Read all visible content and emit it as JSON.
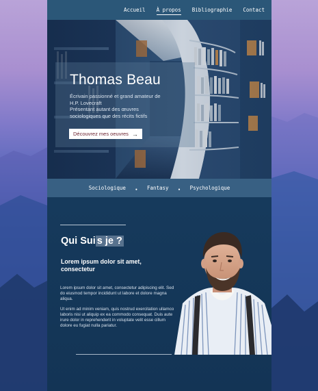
{
  "nav": {
    "items": [
      "Accueil",
      "À propos",
      "Bibliographie",
      "Contact"
    ],
    "active_index": 1
  },
  "hero": {
    "name": "Thomas Beau",
    "description_lines": [
      "Écrivain passionné et grand amateur de",
      "H.P. Lovecraft",
      "Présentant autant des œuvres",
      "sociologiques que des récits fictifs"
    ],
    "cta_label": "Découvrez mes oeuvres",
    "cta_icon": "arrow-right-icon"
  },
  "categories": [
    "Sociologique",
    "Fantasy",
    "Psychologique"
  ],
  "about": {
    "heading_before": "Qui Sui",
    "heading_highlight": "s je ?",
    "subheading": "Lorem ipsum dolor sit amet, consectetur",
    "paragraph1": "Lorem ipsum dolor sit amet, consectetur adipiscing elit. Sed do eiusmod tempor incididunt ut labore et dolore magna aliqua.",
    "paragraph2": "Ut enim ad minim veniam, quis nostrud exercitation ullamco laboris nisi ut aliquip ex ea commodo consequat. Duis aute irure dolor in reprehenderit in voluptate velit esse cillum dolore eu fugiat nulla pariatur."
  },
  "colors": {
    "nav_bg": "#2b5778",
    "category_bar_bg": "#386083",
    "section_bg": "#163a5c",
    "cta_text": "#6a1f2c"
  }
}
